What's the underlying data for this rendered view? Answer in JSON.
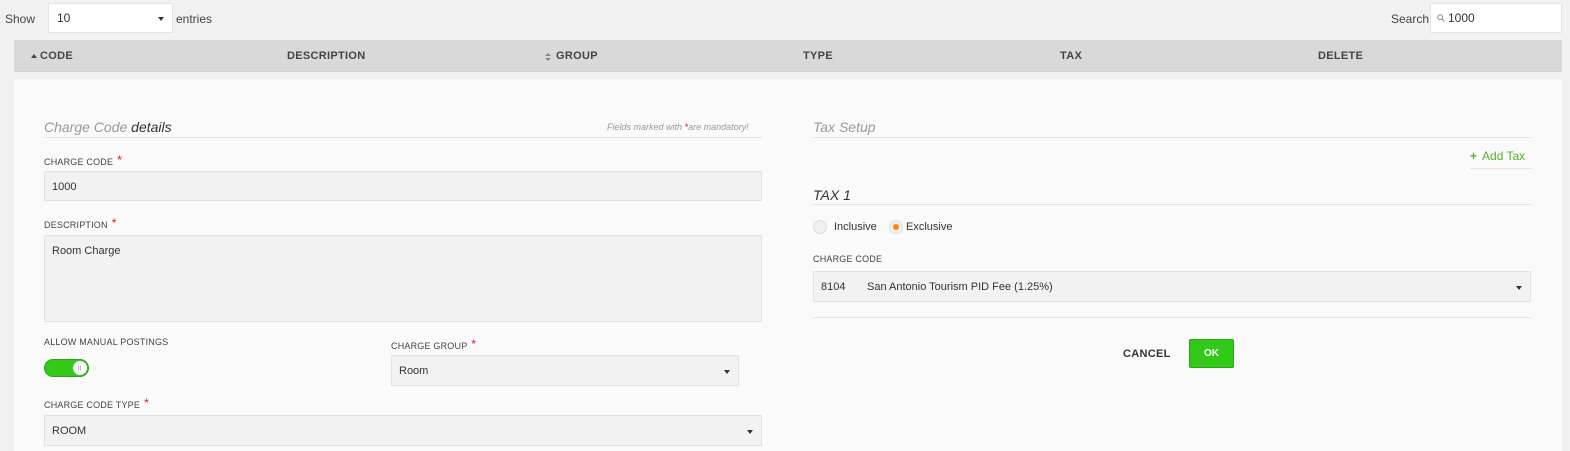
{
  "toolbar": {
    "show_label": "Show",
    "show_value": "10",
    "entries_label": "entries",
    "search_label": "Search",
    "search_value": "1000"
  },
  "table": {
    "headers": [
      "CODE",
      "DESCRIPTION",
      "GROUP",
      "TYPE",
      "TAX",
      "DELETE"
    ]
  },
  "details": {
    "title_light": "Charge Code",
    "title_bold": "details",
    "mandatory_prefix": "Fields marked with",
    "mandatory_star": "*",
    "mandatory_suffix": "are mandatory!",
    "charge_code_label": "CHARGE CODE",
    "charge_code_value": "1000",
    "description_label": "DESCRIPTION",
    "description_value": "Room Charge",
    "allow_manual_label": "ALLOW MANUAL POSTINGS",
    "allow_manual_on": true,
    "charge_group_label": "CHARGE GROUP",
    "charge_group_value": "Room",
    "charge_code_type_label": "CHARGE CODE TYPE",
    "charge_code_type_value": "ROOM"
  },
  "tax_setup": {
    "title": "Tax Setup",
    "add_tax_label": "Add Tax",
    "tax_title": "TAX 1",
    "inclusive_label": "Inclusive",
    "exclusive_label": "Exclusive",
    "selected": "Exclusive",
    "charge_code_label": "CHARGE CODE",
    "charge_code_number": "8104",
    "charge_code_name": "San Antonio Tourism PID Fee (1.25%)"
  },
  "actions": {
    "cancel_label": "CANCEL",
    "ok_label": "OK"
  },
  "colors": {
    "accent_green": "#33c919",
    "link_green": "#56b22e",
    "required_red": "#e2171e",
    "radio_orange": "#ff8a00"
  }
}
